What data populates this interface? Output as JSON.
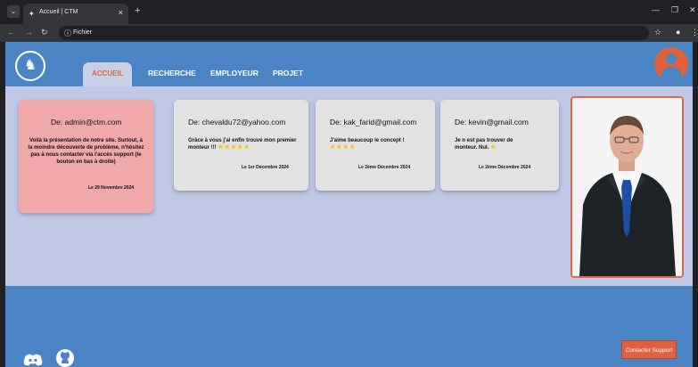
{
  "browser": {
    "tab_title": "Accueil | CTM",
    "tab_close": "×",
    "new_tab": "+",
    "address": "Fichier",
    "icons": [
      "tab-menu-icon",
      "back-icon",
      "forward-icon",
      "reload-icon",
      "info-icon",
      "bookmark-star-icon",
      "profile-icon",
      "more-icon",
      "minimize-icon",
      "maximize-icon",
      "close-window-icon"
    ]
  },
  "header": {
    "nav": {
      "active": "ACCUEIL",
      "recherche": "RECHERCHE",
      "employeur": "EMPLOYEUR",
      "projet": "PROJET"
    },
    "colors": {
      "accent": "#e06040",
      "primary": "#4a84c4",
      "content_bg": "#c0c8e6"
    }
  },
  "cards": [
    {
      "from": "De: admin@ctm.com",
      "message": "Voilà la présentation de notre site. Surtout, à la moindre découverte de problème, n'hésitez pas à nous contacter via l'accès support (le bouton en bas à droite)",
      "date": "Le 29 Novembre 2024"
    },
    {
      "from": "De: chevaldu72@yahoo.com",
      "message": "Grâce à vous j'ai enfin trouvé mon premier monteur !!!",
      "rating": 5,
      "stars": "★★★★★",
      "date": "Le 1er Décembre 2024"
    },
    {
      "from": "De: kak_farid@gmail.com",
      "message": "J'aime beaucoup le concept !",
      "rating": 4,
      "stars": "★★★★",
      "date": "Le 2ème Décembre 2024"
    },
    {
      "from": "De: kevin@gmail.com",
      "message": "Je n est pas trouver de monteur. Nul.",
      "rating": 1,
      "stars": "★",
      "date": "Le 2ème Décembre 2024"
    }
  ],
  "footer": {
    "support_label": "Contacter Support"
  }
}
